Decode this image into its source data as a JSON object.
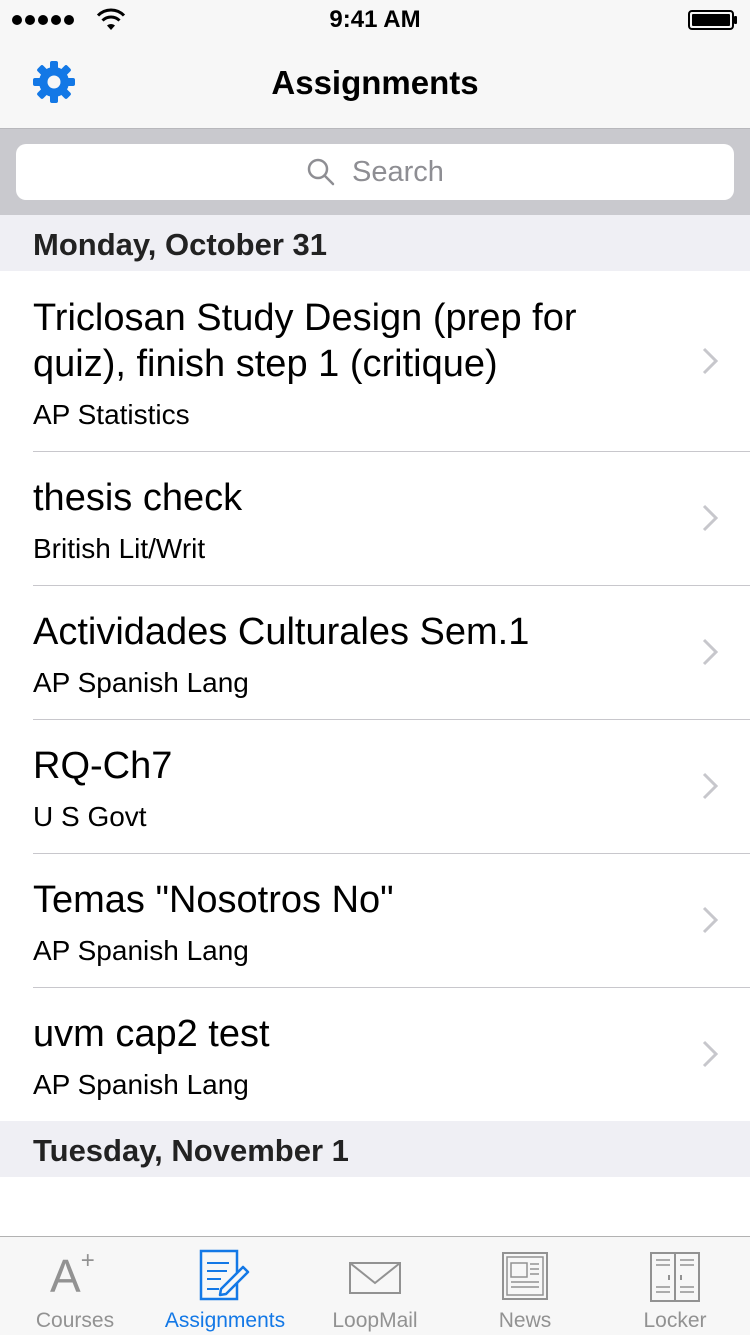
{
  "status_bar": {
    "time": "9:41 AM"
  },
  "nav": {
    "title": "Assignments"
  },
  "search": {
    "placeholder": "Search"
  },
  "sections": [
    {
      "header": "Monday, October 31",
      "items": [
        {
          "title": "Triclosan Study Design (prep for quiz), finish step 1 (critique)",
          "course": "AP Statistics"
        },
        {
          "title": "thesis check",
          "course": "British Lit/Writ"
        },
        {
          "title": "Actividades Culturales Sem.1",
          "course": "AP Spanish Lang"
        },
        {
          "title": "RQ-Ch7",
          "course": "U S Govt"
        },
        {
          "title": "Temas \"Nosotros No\"",
          "course": "AP Spanish Lang"
        },
        {
          "title": "uvm cap2 test",
          "course": "AP Spanish Lang"
        }
      ]
    },
    {
      "header": "Tuesday, November 1",
      "items": []
    }
  ],
  "tab_bar": {
    "tabs": [
      {
        "label": "Courses",
        "icon": "a-plus-icon"
      },
      {
        "label": "Assignments",
        "icon": "pencil-paper-icon",
        "active": true
      },
      {
        "label": "LoopMail",
        "icon": "envelope-icon"
      },
      {
        "label": "News",
        "icon": "newspaper-icon"
      },
      {
        "label": "Locker",
        "icon": "locker-icon"
      }
    ]
  },
  "colors": {
    "accent": "#1378e6",
    "inactive": "#929292",
    "section_bg": "#efeff4",
    "search_bar_bg": "#c9c9ce"
  }
}
